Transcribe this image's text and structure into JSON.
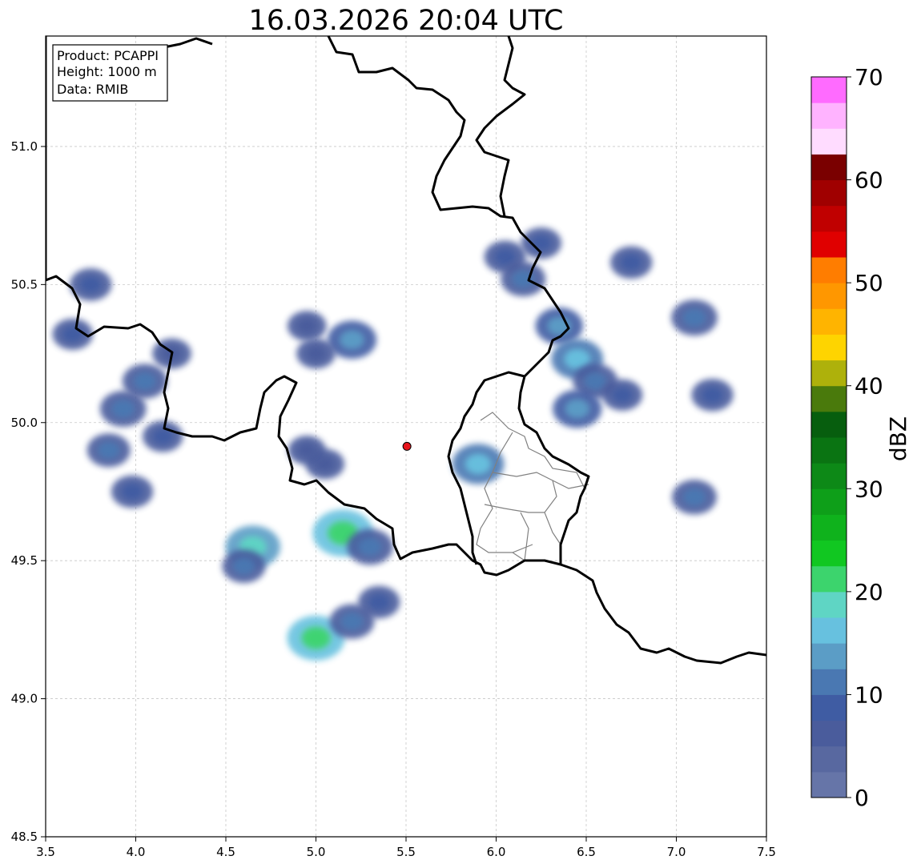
{
  "title": "16.03.2026 20:04 UTC",
  "info_box": {
    "product": "Product: PCAPPI",
    "height": "Height: 1000 m",
    "data": "Data: RMIB"
  },
  "map": {
    "lon_range": [
      3.5,
      7.5
    ],
    "lat_range": [
      48.5,
      51.4
    ],
    "x_ticks": [
      "3.5",
      "4.0",
      "4.5",
      "5.0",
      "5.5",
      "6.0",
      "6.5",
      "7.0",
      "7.5"
    ],
    "y_ticks": [
      "48.5",
      "49.0",
      "49.5",
      "50.0",
      "50.5",
      "51.0"
    ],
    "grid": true,
    "radar_site": {
      "lon": 5.505,
      "lat": 49.914,
      "color": "#e8141c"
    },
    "echo_cells": [
      {
        "lon": 3.93,
        "lat": 50.05,
        "dbz": 12
      },
      {
        "lon": 3.85,
        "lat": 49.9,
        "dbz": 10
      },
      {
        "lon": 3.98,
        "lat": 49.75,
        "dbz": 9
      },
      {
        "lon": 4.05,
        "lat": 50.15,
        "dbz": 11
      },
      {
        "lon": 3.75,
        "lat": 50.5,
        "dbz": 9
      },
      {
        "lon": 3.65,
        "lat": 50.32,
        "dbz": 8
      },
      {
        "lon": 4.15,
        "lat": 49.95,
        "dbz": 8
      },
      {
        "lon": 4.2,
        "lat": 50.25,
        "dbz": 7
      },
      {
        "lon": 4.65,
        "lat": 49.55,
        "dbz": 18
      },
      {
        "lon": 4.6,
        "lat": 49.48,
        "dbz": 10
      },
      {
        "lon": 5.15,
        "lat": 49.6,
        "dbz": 22
      },
      {
        "lon": 5.3,
        "lat": 49.55,
        "dbz": 12
      },
      {
        "lon": 5.35,
        "lat": 49.35,
        "dbz": 9
      },
      {
        "lon": 5.0,
        "lat": 49.22,
        "dbz": 20
      },
      {
        "lon": 5.2,
        "lat": 49.28,
        "dbz": 11
      },
      {
        "lon": 5.2,
        "lat": 50.3,
        "dbz": 14
      },
      {
        "lon": 4.95,
        "lat": 50.35,
        "dbz": 7
      },
      {
        "lon": 5.0,
        "lat": 50.25,
        "dbz": 7
      },
      {
        "lon": 5.05,
        "lat": 49.85,
        "dbz": 7
      },
      {
        "lon": 4.95,
        "lat": 49.9,
        "dbz": 6
      },
      {
        "lon": 5.9,
        "lat": 49.85,
        "dbz": 16
      },
      {
        "lon": 6.05,
        "lat": 50.6,
        "dbz": 9
      },
      {
        "lon": 6.15,
        "lat": 50.52,
        "dbz": 11
      },
      {
        "lon": 6.25,
        "lat": 50.65,
        "dbz": 8
      },
      {
        "lon": 6.35,
        "lat": 50.35,
        "dbz": 13
      },
      {
        "lon": 6.45,
        "lat": 50.23,
        "dbz": 16
      },
      {
        "lon": 6.55,
        "lat": 50.15,
        "dbz": 11
      },
      {
        "lon": 6.45,
        "lat": 50.05,
        "dbz": 14
      },
      {
        "lon": 6.7,
        "lat": 50.1,
        "dbz": 8
      },
      {
        "lon": 6.75,
        "lat": 50.58,
        "dbz": 9
      },
      {
        "lon": 7.1,
        "lat": 50.38,
        "dbz": 12
      },
      {
        "lon": 7.2,
        "lat": 50.1,
        "dbz": 9
      },
      {
        "lon": 7.1,
        "lat": 49.73,
        "dbz": 11
      }
    ]
  },
  "colorbar": {
    "label": "dBZ",
    "range": [
      0,
      70
    ],
    "step": 2.5,
    "ticks": [
      "0",
      "10",
      "20",
      "30",
      "40",
      "50",
      "60",
      "70"
    ],
    "colors": [
      "#6675a8",
      "#5868a0",
      "#4a5c9c",
      "#3f5ca3",
      "#4a78b2",
      "#5b9dc6",
      "#67c1df",
      "#5fd5c4",
      "#3cd46d",
      "#11c721",
      "#0fb21c",
      "#0e9f19",
      "#0d8917",
      "#0a7412",
      "#075e0e",
      "#4a7a0c",
      "#aeb10b",
      "#fed400",
      "#ffb400",
      "#ff9700",
      "#ff7d00",
      "#e00000",
      "#c00000",
      "#a00000",
      "#7a0000",
      "#ffdcff",
      "#ffb3ff",
      "#ff6bff",
      "#ee33ee"
    ]
  }
}
